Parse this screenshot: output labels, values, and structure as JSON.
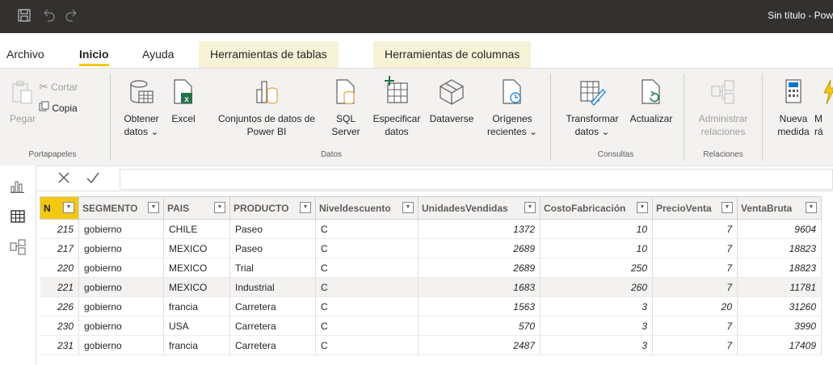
{
  "app": {
    "window_title": "Sin título - Pow"
  },
  "tabs": [
    {
      "label": "Archivo"
    },
    {
      "label": "Inicio"
    },
    {
      "label": "Ayuda"
    },
    {
      "label": "Herramientas de tablas"
    },
    {
      "label": "Herramientas de columnas"
    }
  ],
  "ribbon": {
    "pegar": "Pegar",
    "cortar": "Cortar",
    "copia": "Copia",
    "portapapeles": "Portapapeles",
    "obtener_l1": "Obtener",
    "obtener_l2": "datos ⌄",
    "excel": "Excel",
    "conjuntos_l1": "Conjuntos de datos de",
    "conjuntos_l2": "Power BI",
    "sql_l1": "SQL",
    "sql_l2": "Server",
    "especificar_l1": "Especificar",
    "especificar_l2": "datos",
    "dataverse": "Dataverse",
    "origenes_l1": "Orígenes",
    "origenes_l2": "recientes ⌄",
    "datos_group": "Datos",
    "transformar_l1": "Transformar",
    "transformar_l2": "datos ⌄",
    "actualizar": "Actualizar",
    "consultas_group": "Consultas",
    "administrar_l1": "Administrar",
    "administrar_l2": "relaciones",
    "relaciones_group": "Relaciones",
    "nueva_l1": "Nueva",
    "nueva_l2": "medida",
    "medida_rapida_l1": "M",
    "medida_rapida_l2": "rá"
  },
  "table": {
    "columns": [
      "N",
      "SEGMENTO",
      "PAIS",
      "PRODUCTO",
      "Niveldescuento",
      "UnidadesVendidas",
      "CostoFabricación",
      "PrecioVenta",
      "VentaBruta"
    ],
    "rows": [
      [
        "215",
        "gobierno",
        "CHILE",
        "Paseo",
        "C",
        "1372",
        "10",
        "7",
        "9604"
      ],
      [
        "217",
        "gobierno",
        "MEXICO",
        "Paseo",
        "C",
        "2689",
        "10",
        "7",
        "18823"
      ],
      [
        "220",
        "gobierno",
        "MEXICO",
        "Trial",
        "C",
        "2689",
        "250",
        "7",
        "18823"
      ],
      [
        "221",
        "gobierno",
        "MEXICO",
        "Industrial",
        "C",
        "1683",
        "260",
        "7",
        "11781"
      ],
      [
        "226",
        "gobierno",
        "francia",
        "Carretera",
        "C",
        "1563",
        "3",
        "20",
        "31260"
      ],
      [
        "230",
        "gobierno",
        "USA",
        "Carretera",
        "C",
        "570",
        "3",
        "7",
        "3990"
      ],
      [
        "231",
        "gobierno",
        "francia",
        "Carretera",
        "C",
        "2487",
        "3",
        "7",
        "17409"
      ]
    ]
  }
}
